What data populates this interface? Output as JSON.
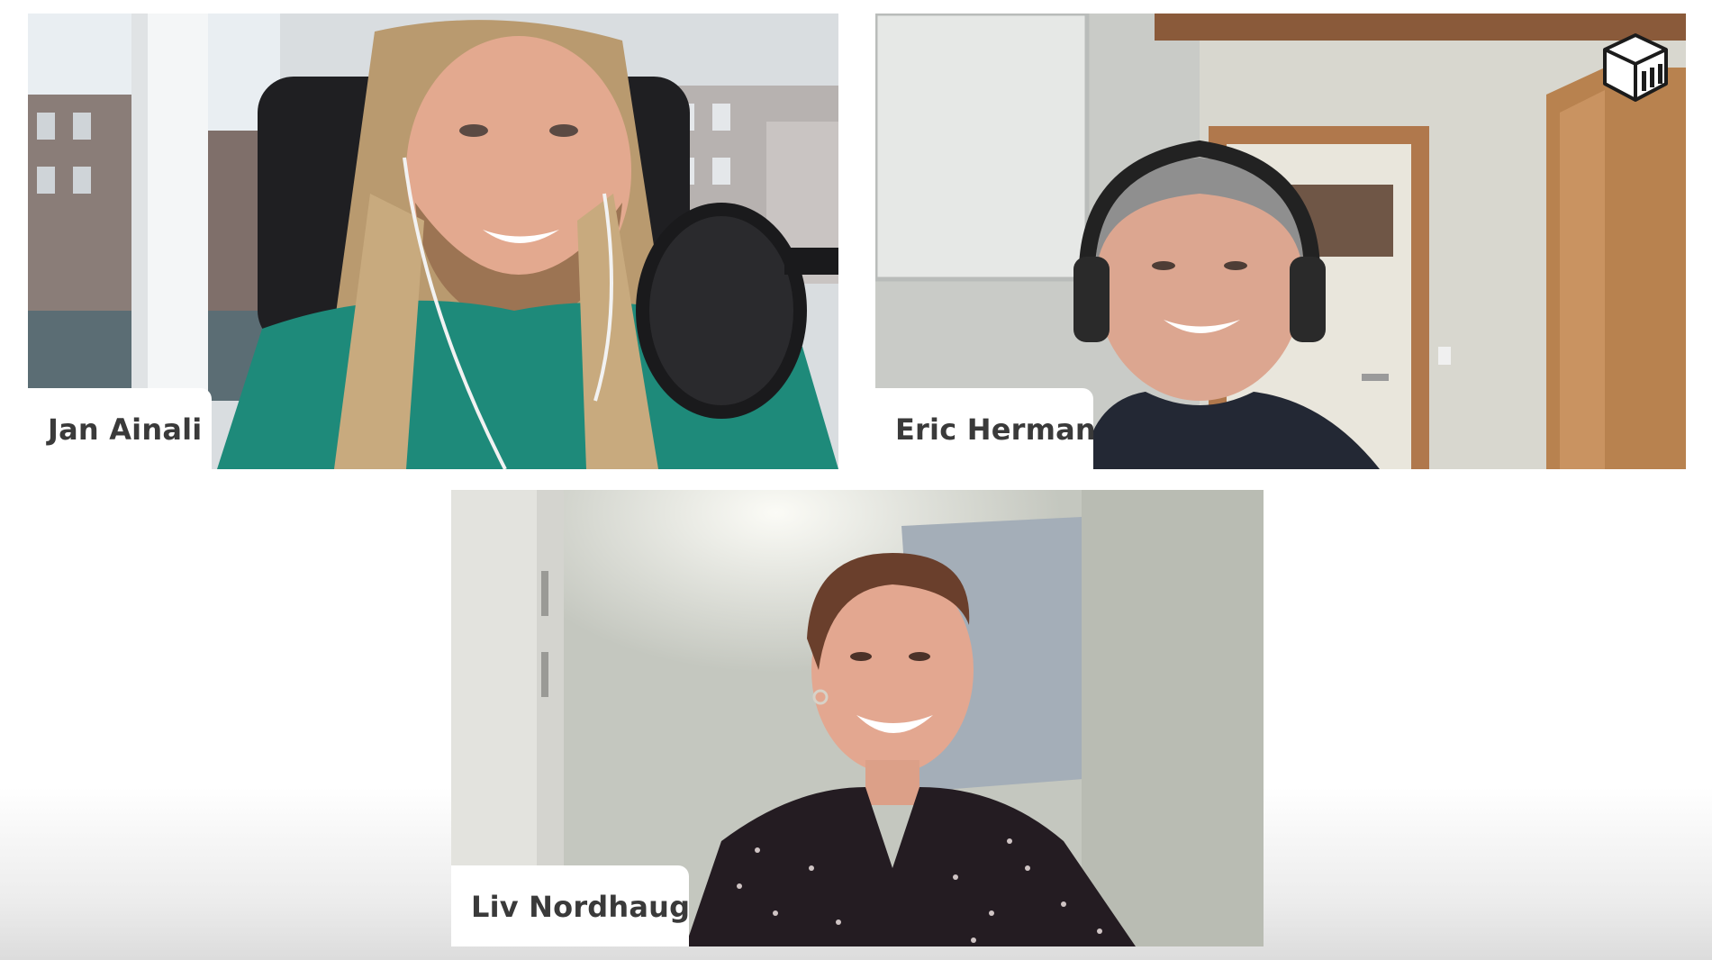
{
  "participants": [
    {
      "name": "Jan Ainali"
    },
    {
      "name": "Eric Herman"
    },
    {
      "name": "Liv Nordhaug"
    }
  ],
  "brand": {
    "icon": "open-box-bars-logo-icon"
  },
  "colors": {
    "nametag_bg": "#ffffff",
    "nametag_text": "#3a3a3a",
    "background": "#ffffff"
  }
}
